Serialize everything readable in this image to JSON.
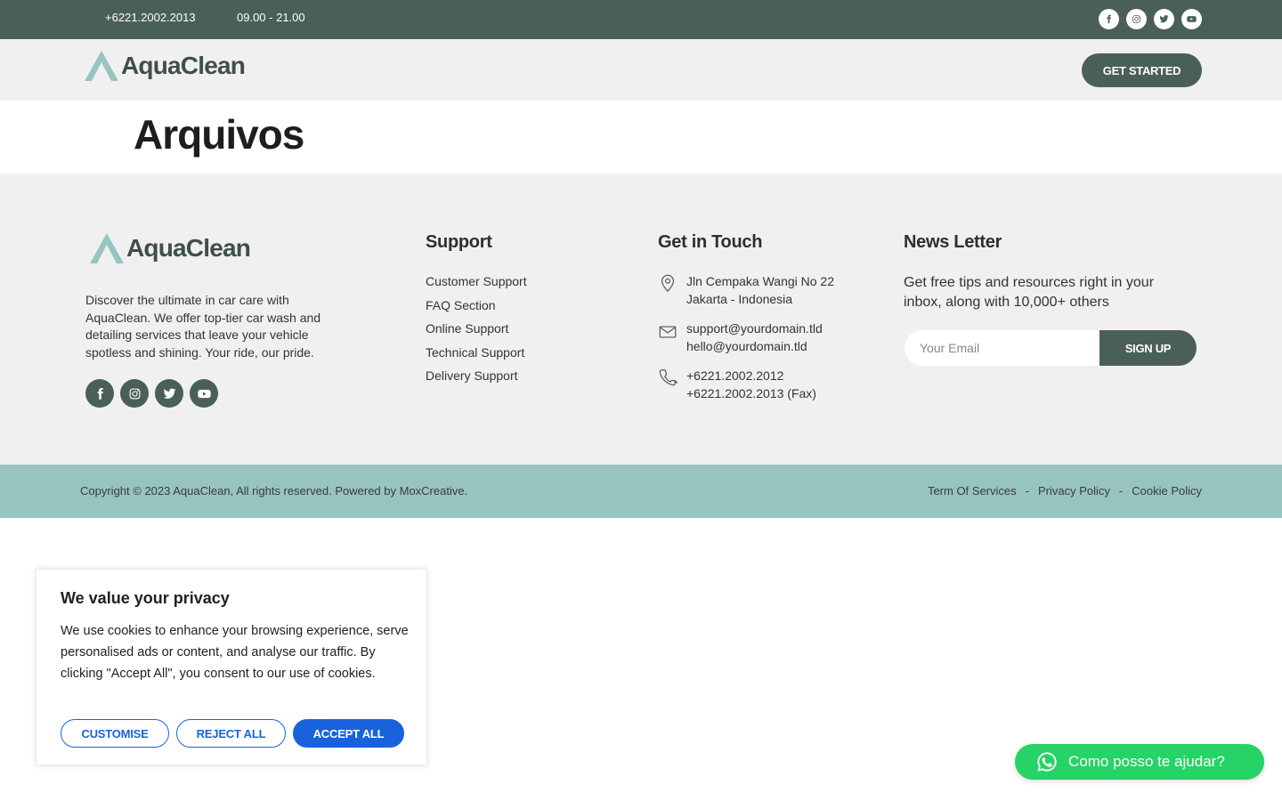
{
  "topbar": {
    "phone": "+6221.2002.2013",
    "hours": "09.00 - 21.00",
    "social": [
      "facebook-icon",
      "instagram-icon",
      "twitter-icon",
      "youtube-icon"
    ]
  },
  "header": {
    "logo_text": "AquaClean",
    "cta_label": "GET STARTED"
  },
  "page": {
    "title": "Arquivos"
  },
  "footer": {
    "logo_text": "AquaClean",
    "description": "Discover the ultimate in car care with AquaClean. We offer top-tier car wash and detailing services that leave your vehicle spotless and shining. Your ride, our pride.",
    "support": {
      "title": "Support",
      "links": [
        "Customer Support",
        "FAQ Section",
        "Online Support",
        "Technical Support",
        "Delivery Support"
      ]
    },
    "contact": {
      "title": "Get in Touch",
      "address_1": "Jln Cempaka Wangi No 22",
      "address_2": "Jakarta - Indonesia",
      "email_1": "support@yourdomain.tld",
      "email_2": "hello@yourdomain.tld",
      "phone_1": "+6221.2002.2012",
      "phone_2": "+6221.2002.2013 (Fax)"
    },
    "newsletter": {
      "title": "News Letter",
      "text": "Get free tips and resources right in your inbox, along with 10,000+ others",
      "placeholder": "Your Email",
      "button": "SIGN UP"
    }
  },
  "bottombar": {
    "copyright": "Copyright © 2023 AquaClean, All rights reserved. Powered by MoxCreative.",
    "links": [
      "Term Of Services",
      "Privacy Policy",
      "Cookie Policy"
    ],
    "separator": "-"
  },
  "cookie": {
    "title": "We value your privacy",
    "text": "We use cookies to enhance your browsing experience, serve personalised ads or content, and analyse our traffic. By clicking \"Accept All\", you consent to our use of cookies.",
    "customise": "CUSTOMISE",
    "reject": "REJECT ALL",
    "accept": "ACCEPT ALL"
  },
  "whatsapp": {
    "label": "Como posso te ajudar?"
  },
  "colors": {
    "primary": "#4a5f58",
    "accent": "#97c4c0",
    "light_bg": "#f0f0f0",
    "cookie_blue": "#1863dc",
    "whatsapp_green": "#25d366"
  }
}
